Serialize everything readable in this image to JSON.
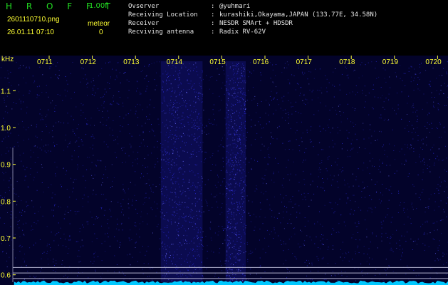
{
  "header": {
    "app_name": "H R O F F T",
    "version": "1.00f",
    "filename": "2601110710.png",
    "datetime": "26.01.11 07:10",
    "meteor_label": "meteor",
    "meteor_count": "0"
  },
  "metadata": [
    {
      "label": "Ovserver",
      "value": "@yuhmari"
    },
    {
      "label": "Receiving Location",
      "value": "kurashiki,Okayama,JAPAN (133.77E, 34.58N)"
    },
    {
      "label": "Receiver",
      "value": "NESDR SMArt + HDSDR"
    },
    {
      "label": "Recviving antenna",
      "value": "Radix RV-62V"
    }
  ],
  "chart_data": {
    "type": "heatmap",
    "ylabel": "kHz",
    "x_ticks": [
      "0711",
      "0712",
      "0713",
      "0714",
      "0715",
      "0716",
      "0717",
      "0718",
      "0719",
      "0720"
    ],
    "y_ticks": [
      "1.1",
      "1.0",
      "0.9",
      "0.8",
      "0.7",
      "0.6"
    ],
    "y_range_khz": [
      0.58,
      1.18
    ],
    "high_noise_time_bands": [
      {
        "from": "0714",
        "to": "0715"
      },
      {
        "from": "0715.5",
        "to": "0716"
      }
    ],
    "reference_lines_khz": [
      0.62,
      0.605,
      0.59
    ],
    "colors": {
      "background": "#03032a",
      "noise": "#2b2bd6",
      "noise_bright": "#6a6aff",
      "baseline": "#00c8ff",
      "reference_line": "#b4b4d2",
      "tick_text": "#ffff33"
    }
  }
}
